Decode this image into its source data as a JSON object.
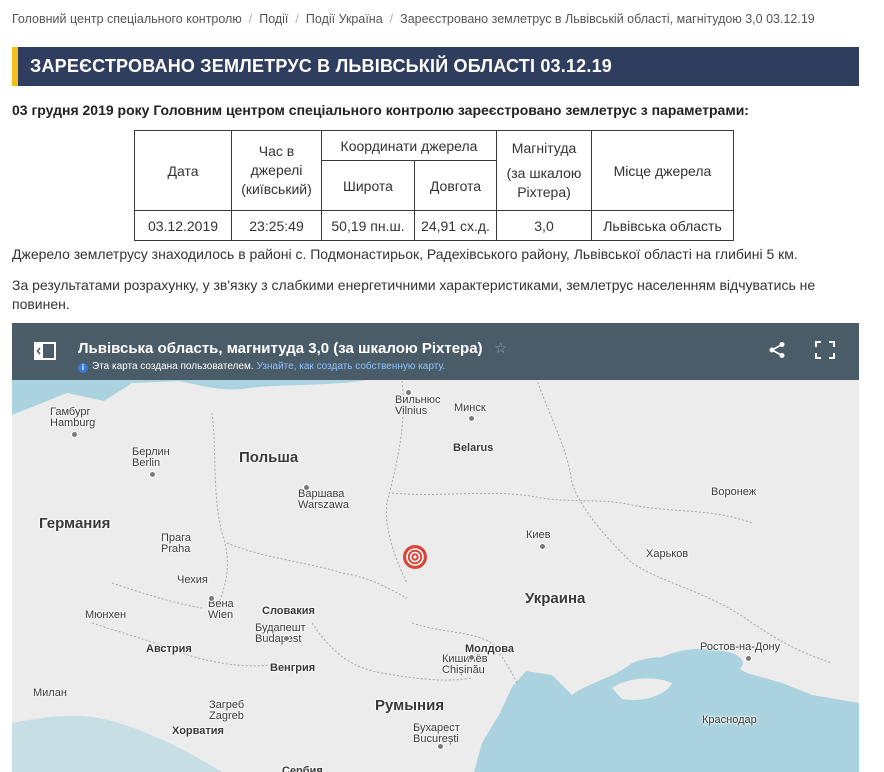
{
  "breadcrumb": {
    "items": [
      "Головний центр спеціального контролю",
      "Події",
      "Події Україна",
      "Зареєстровано землетрус в Львівській області, магнітудою 3,0 03.12.19"
    ],
    "separator": "/"
  },
  "page": {
    "title": "ЗАРЕЄСТРОВАНО ЗЕМЛЕТРУС В ЛЬВІВСЬКІЙ ОБЛАСТІ 03.12.19",
    "intro": "03 грудня 2019 року Головним центром спеціального контролю зареєстровано землетрус з параметрами:",
    "paragraph1": "Джерело землетрусу знаходилось в районі с. Подмонастирьок, Радехівського району, Львівської області  на глибині 5 км.",
    "paragraph2": "За результатами розрахунку, у зв'язку з слабкими енергетичними характеристиками, землетрус населенням відчуватись не повинен."
  },
  "table": {
    "headers": {
      "date": "Дата",
      "time": "Час в джерелі (київський)",
      "coords": "Координати джерела",
      "lat": "Широта",
      "lon": "Довгота",
      "magnitude_line1": "Магнітуда",
      "magnitude_line2": "(за шкалою Ріхтера)",
      "place": "Місце джерела"
    },
    "row": {
      "date": "03.12.2019",
      "time": "23:25:49",
      "lat": "50,19 пн.ш.",
      "lon": "24,91 сх.д.",
      "magnitude": "3,0",
      "place": "Львівська область"
    }
  },
  "map": {
    "title": "Львівська область, магнитуда 3,0 (за шкалою Ріхтера)",
    "subtitle": "Эта карта создана пользователем.",
    "subtitle_link": "Узнайте, как создать собственную карту.",
    "info_glyph": "i",
    "star_glyph": "☆",
    "colors": {
      "water": "#aad3df",
      "land": "#ececec",
      "header": "#4a5c68",
      "marker": "#d8453a"
    },
    "icons": [
      "sidebar-toggle-icon",
      "star-icon",
      "share-icon",
      "fullscreen-icon"
    ],
    "countries": {
      "poland": "Польша",
      "germany": "Германия",
      "belarus": "Belarus",
      "ukraine": "Украина",
      "romania": "Румыния",
      "slovakia": "Словакия",
      "austria": "Австрия",
      "hungary": "Венгрия",
      "croatia": "Хорватия",
      "moldova": "Молдова",
      "serbia": "Сербия"
    },
    "cities": {
      "hamburg": "Гамбург\nHamburg",
      "berlin": "Берлин\nBerlin",
      "warsaw": "Варшава\nWarszawa",
      "vilnius": "Вильнюс\nVilnius",
      "minsk": "Минск",
      "voronezh": "Воронеж",
      "kiev": "Киев",
      "kharkov": "Харьков",
      "prague": "Прага\nPraha",
      "czechia": "Чехия",
      "vienna": "Вена\nWien",
      "munich": "Мюнхен",
      "budapest": "Будапешт\nBudapest",
      "kishinev": "Кишинёв\nChișinău",
      "rostov": "Ростов-на-Дону",
      "milan": "Милан",
      "zagreb": "Загреб\nZagreb",
      "bucharest": "Бухарест\nBucurești",
      "krasnodar": "Краснодар"
    }
  }
}
